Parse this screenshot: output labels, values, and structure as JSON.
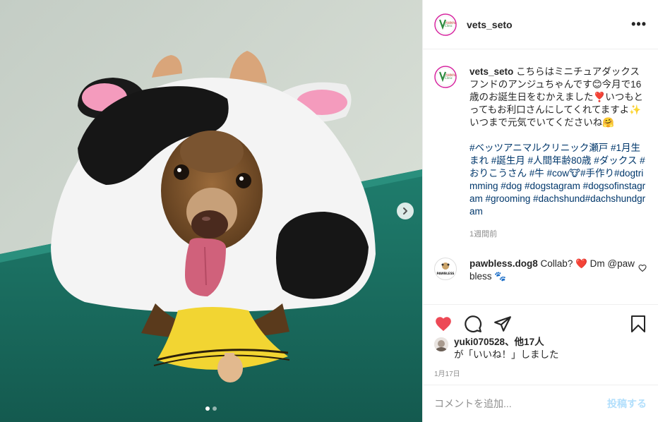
{
  "post": {
    "username": "vets_seto",
    "more_label": "•••"
  },
  "caption": {
    "username": "vets_seto",
    "text": "こちらはミニチュアダックスフンドのアンジュちゃんです😊今月で16歳のお誕生日をむかえました❣️いつもとってもお利口さんにしてくれてますよ✨いつまで元気でいてくださいね🤗",
    "hashtags": "#ベッツアニマルクリニック瀬戸 #1月生まれ #誕生月 #人間年齢80歳 #ダックス #おりこうさん #牛 #cow🐮#手作り#dogtrimming #dog #dogstagram #dogsofinstagram #grooming #dachshund#dachshundgram",
    "time_ago": "1週間前"
  },
  "comment": {
    "username": "pawbless.dog8",
    "text": "Collab? ❤️ Dm @pawbless 🐾",
    "avatar_text": "PAWBLESS"
  },
  "likes": {
    "user": "yuki070528",
    "others": "、他17人",
    "suffix": "が「いいね！」しました"
  },
  "date": "1月17日",
  "add_comment": {
    "placeholder": "コメントを追加...",
    "post_label": "投稿する"
  },
  "carousel": {
    "count": 2,
    "active": 1
  },
  "colors": {
    "accent_red": "#ed4956",
    "link": "#00376b",
    "muted": "#8e8e8e",
    "post_disabled": "#b2dffc"
  }
}
